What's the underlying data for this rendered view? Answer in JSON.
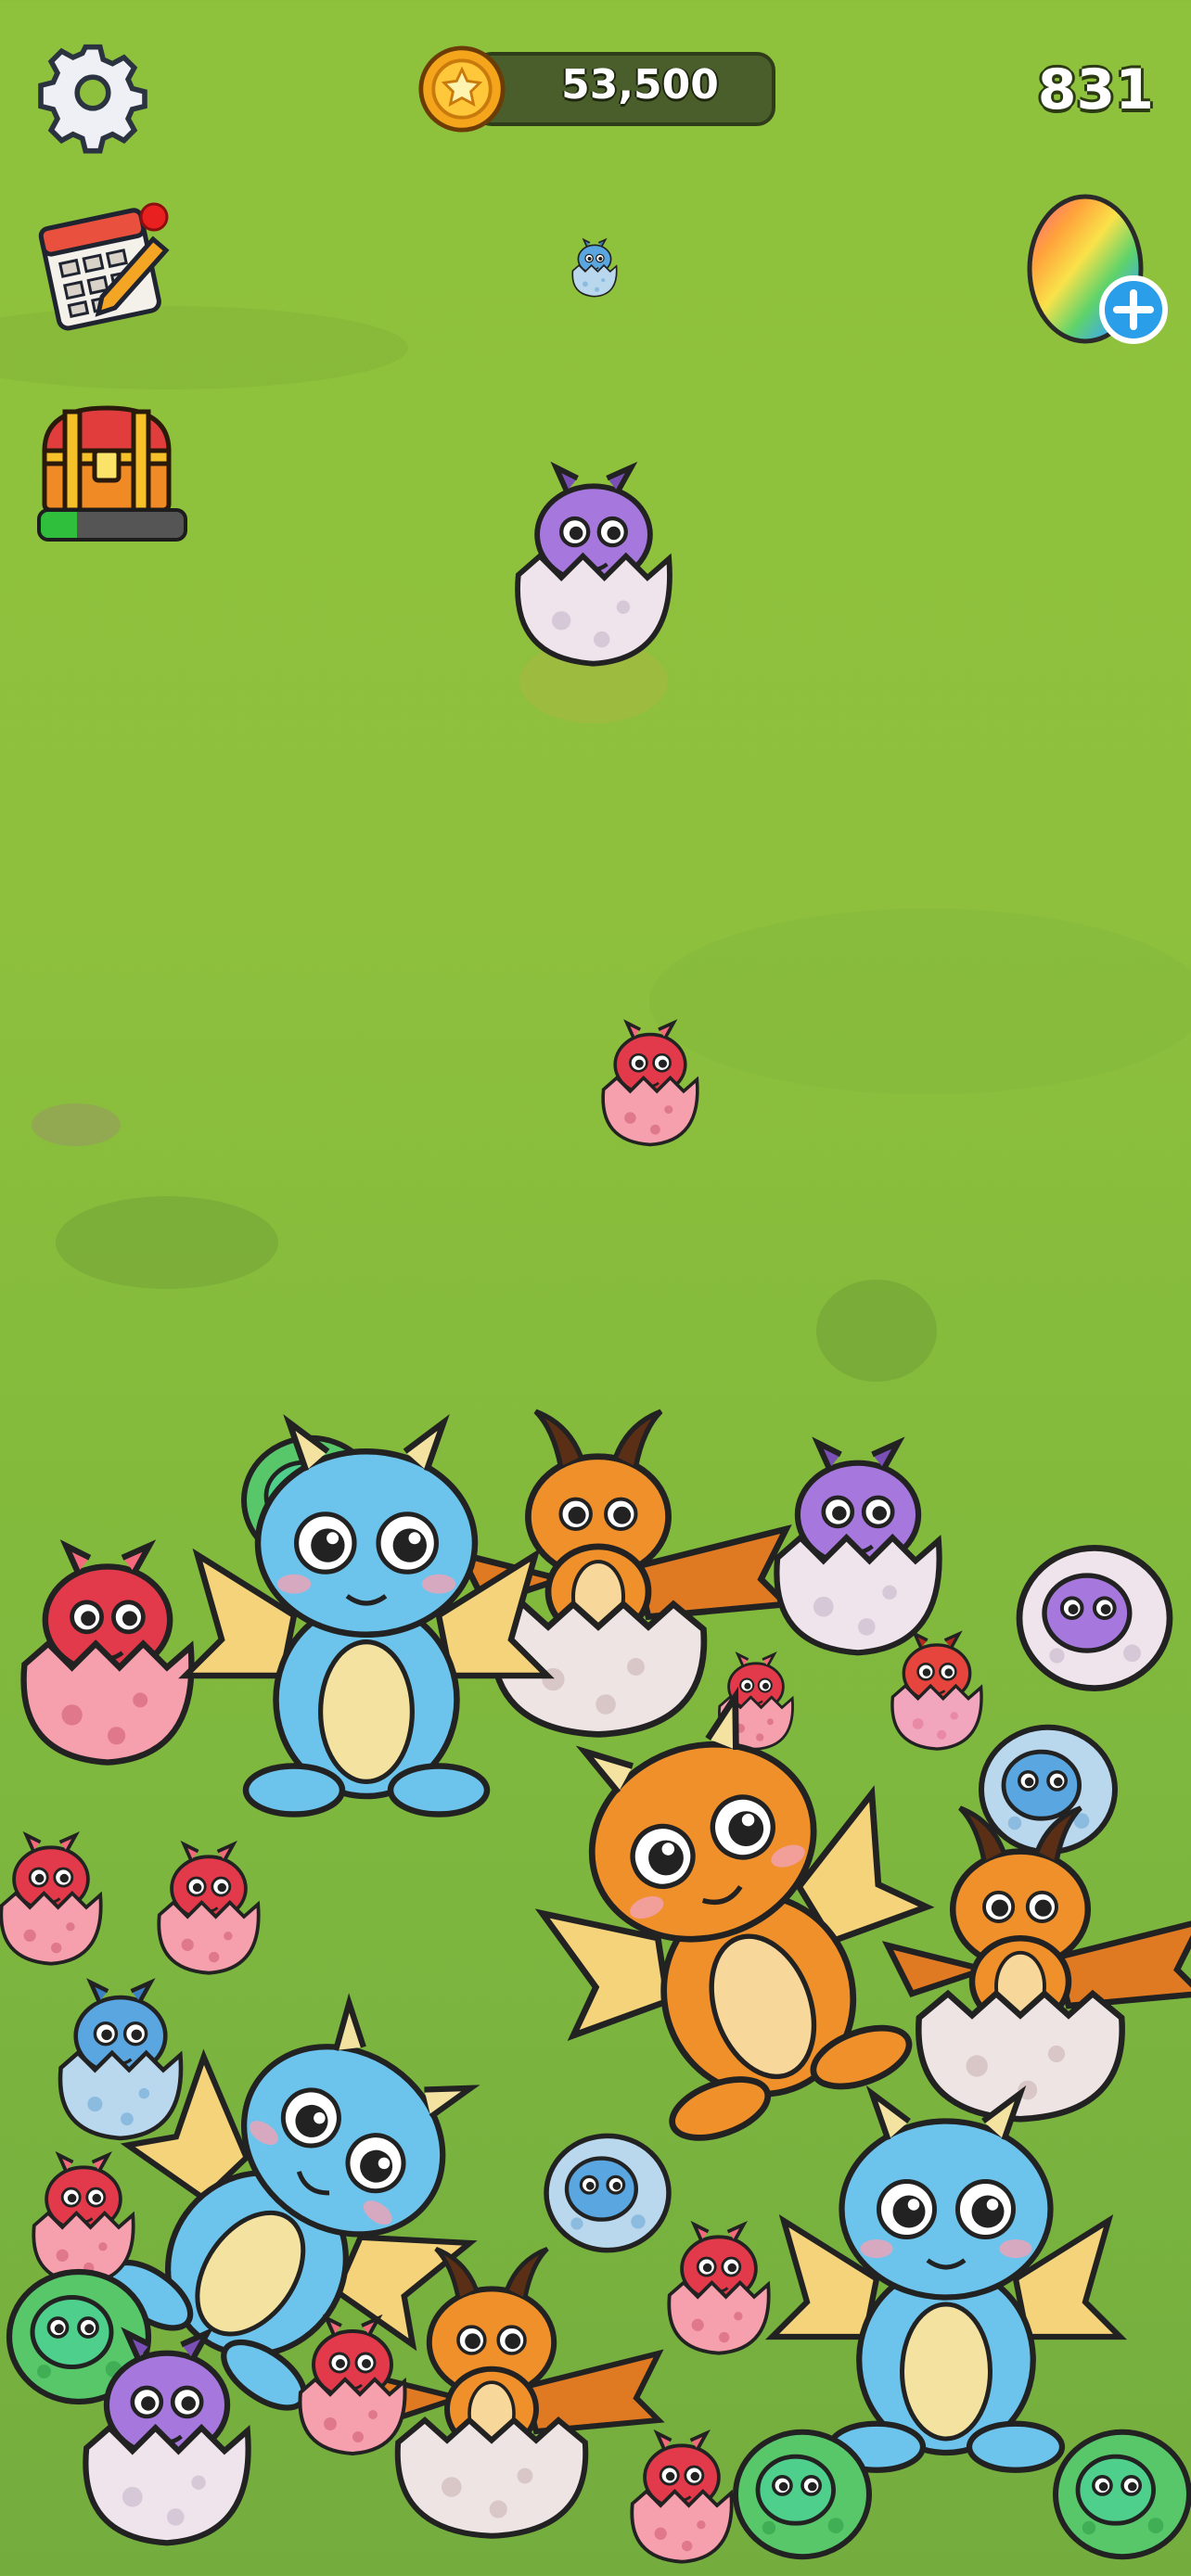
{
  "hud": {
    "coins": "53,500",
    "score": "831",
    "chest_progress": 0.25
  },
  "icons": {
    "settings": "gear-icon",
    "calendar": "calendar-icon",
    "chest": "treasure-chest-icon",
    "coin": "coin-icon",
    "egg_shop": "rainbow-egg-plus-icon"
  },
  "colors": {
    "grass": "#8ec03d",
    "coin_track": "#4a5e2b",
    "progress_fill": "#2fbf3c"
  }
}
